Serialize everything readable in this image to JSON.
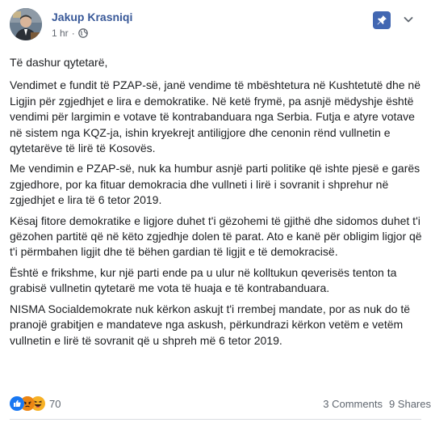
{
  "post": {
    "author": "Jakup Krasniqi",
    "time": "1 hr",
    "separator": "·",
    "audience_icon": "globe-icon",
    "pin_icon": "pin-icon",
    "menu_icon": "chevron-down-icon",
    "paragraphs": [
      "Të dashur qytetarë,",
      "Vendimet e fundit të PZAP-së, janë vendime të mbështetura në Kushtetutë dhe në Ligjin për zgjedhjet e lira e demokratike. Në ketë frymë, pa asnjë mëdyshje është vendimi për largimin e votave të kontrabanduara nga Serbia. Futja e atyre votave në sistem nga KQZ-ja, ishin kryekrejt antiligjore dhe cenonin rënd vullnetin e qytetarëve të lirë të Kosovës.",
      "Me vendimin e PZAP-së, nuk ka humbur asnjë parti politike që ishte pjesë e garës zgjedhore, por ka fituar demokracia dhe vullneti i lirë i sovranit i shprehur në zgjedhjet e lira të 6 tetor 2019.",
      "Kësaj fitore demokratike e ligjore duhet t'i gëzohemi të gjithë dhe sidomos duhet t'i gëzohen partitë që në këto zgjedhje dolen të parat. Ato e kanë për obligim ligjor që t'i përmbahen ligjit dhe të bëhen gardian të ligjit e të demokracisë.",
      "Është e frikshme, kur një parti ende pa u ulur në kolltukun qeverisës tenton ta grabisë vullnetin qytetarë me vota të huaja e të kontrabanduara.",
      "NISMA Socialdemokrate nuk kërkon askujt t'i rrembej mandate, por as nuk do të pranojë grabitjen e mandateve nga askush, përkundrazi kërkon vetëm e vetëm vullnetin e lirë të sovranit që u shpreh më 6 tetor 2019."
    ],
    "reactions": {
      "icons": [
        "like-icon",
        "angry-icon",
        "haha-icon"
      ],
      "count": "70",
      "colors": {
        "like": "#1877f2",
        "angry": "#e9710f",
        "haha": "#f7b125"
      }
    },
    "comments_label": "3 Comments",
    "shares_label": "9 Shares"
  },
  "colors": {
    "author": "#385898",
    "text": "#1c1e21",
    "meta": "#616770",
    "pin_bg": "#4267b2"
  }
}
